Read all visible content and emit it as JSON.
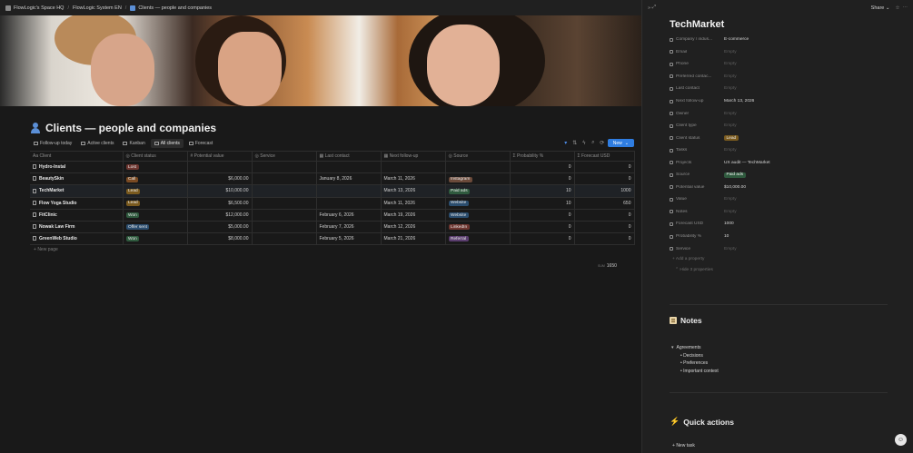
{
  "breadcrumb": [
    {
      "label": "FlowLogic's Space HQ"
    },
    {
      "label": "FlowLogic System EN"
    },
    {
      "label": "Clients — people and companies"
    }
  ],
  "page": {
    "title": "Clients — people and companies",
    "icon": "person-icon"
  },
  "views": [
    {
      "label": "Follow-up today",
      "active": false
    },
    {
      "label": "Active clients",
      "active": false
    },
    {
      "label": "Kanban",
      "active": false
    },
    {
      "label": "All clients",
      "active": true
    },
    {
      "label": "Forecast",
      "active": false
    }
  ],
  "toolbar": {
    "new_label": "New"
  },
  "table": {
    "columns": [
      "Client",
      "Client status",
      "Potential value",
      "Service",
      "Last contact",
      "Next follow-up",
      "Source",
      "Probability %",
      "Forecast USD"
    ],
    "rows": [
      {
        "client": "Hydro-Instal",
        "status": "Lost",
        "status_color": "#6e3630",
        "value": "",
        "service": "",
        "last": "",
        "next": "",
        "source": "",
        "source_color": "",
        "prob": "0",
        "forecast": "0"
      },
      {
        "client": "BeautySkin",
        "status": "Call",
        "status_color": "#7a4a22",
        "value": "$6,000.00",
        "service": "",
        "last": "January 8, 2026",
        "next": "March 11, 2026",
        "source": "Instagram",
        "source_color": "#6b4a3a",
        "prob": "0",
        "forecast": "0"
      },
      {
        "client": "TechMarket",
        "status": "Lead",
        "status_color": "#7a5a1e",
        "value": "$10,000.00",
        "service": "",
        "last": "",
        "next": "March 13, 2026",
        "source": "Paid ads",
        "source_color": "#2f5a3e",
        "prob": "10",
        "forecast": "1000"
      },
      {
        "client": "Flow Yoga Studio",
        "status": "Lead",
        "status_color": "#7a5a1e",
        "value": "$6,500.00",
        "service": "",
        "last": "",
        "next": "March 11, 2026",
        "source": "Website",
        "source_color": "#2b4d6e",
        "prob": "10",
        "forecast": "650"
      },
      {
        "client": "FitClinic",
        "status": "Won",
        "status_color": "#2f5a3e",
        "value": "$12,000.00",
        "service": "",
        "last": "February 6, 2026",
        "next": "March 19, 2026",
        "source": "Website",
        "source_color": "#2b4d6e",
        "prob": "0",
        "forecast": "0"
      },
      {
        "client": "Nowak Law Firm",
        "status": "Offer sent",
        "status_color": "#2b4d6e",
        "value": "$5,000.00",
        "service": "",
        "last": "February 7, 2026",
        "next": "March 12, 2026",
        "source": "LinkedIn",
        "source_color": "#6e3630",
        "prob": "0",
        "forecast": "0"
      },
      {
        "client": "GreenWeb Studio",
        "status": "Won",
        "status_color": "#2f5a3e",
        "value": "$8,000.00",
        "service": "",
        "last": "February 5, 2026",
        "next": "March 21, 2026",
        "source": "Referral",
        "source_color": "#5a3d6e",
        "prob": "0",
        "forecast": "0"
      }
    ],
    "new_page_label": "New page",
    "sum_label": "SUM",
    "sum_value": "1650"
  },
  "panel": {
    "share_label": "Share",
    "title": "TechMarket",
    "properties": [
      {
        "name": "Company / indus...",
        "value": "E-commerce",
        "empty": false
      },
      {
        "name": "Email",
        "value": "Empty",
        "empty": true
      },
      {
        "name": "Phone",
        "value": "Empty",
        "empty": true
      },
      {
        "name": "Preferred contac...",
        "value": "Empty",
        "empty": true
      },
      {
        "name": "Last contact",
        "value": "Empty",
        "empty": true
      },
      {
        "name": "Next follow-up",
        "value": "March 13, 2026",
        "empty": false
      },
      {
        "name": "Owner",
        "value": "Empty",
        "empty": true
      },
      {
        "name": "Client type",
        "value": "Empty",
        "empty": true
      },
      {
        "name": "Client status",
        "value": "Lead",
        "empty": false,
        "tag_color": "#7a5a1e"
      },
      {
        "name": "Tasks",
        "value": "Empty",
        "empty": true
      },
      {
        "name": "Projects",
        "value": "UX audit — TechMarket",
        "empty": false
      },
      {
        "name": "Source",
        "value": "Paid ads",
        "empty": false,
        "tag_color": "#2f5a3e"
      },
      {
        "name": "Potential value",
        "value": "$10,000.00",
        "empty": false
      },
      {
        "name": "Value",
        "value": "Empty",
        "empty": true
      },
      {
        "name": "Notes",
        "value": "Empty",
        "empty": true
      },
      {
        "name": "Forecast USD",
        "value": "1000",
        "empty": false
      },
      {
        "name": "Probability %",
        "value": "10",
        "empty": false
      },
      {
        "name": "Service",
        "value": "Empty",
        "empty": true
      }
    ],
    "add_property_label": "Add a property",
    "hide_props_label": "Hide 3 properties",
    "notes_title": "Notes",
    "notes_toggle": "Agreements",
    "notes_items": [
      "Decisions",
      "Preferences",
      "Important context"
    ],
    "quick_title": "Quick actions",
    "new_task_label": "New task"
  }
}
